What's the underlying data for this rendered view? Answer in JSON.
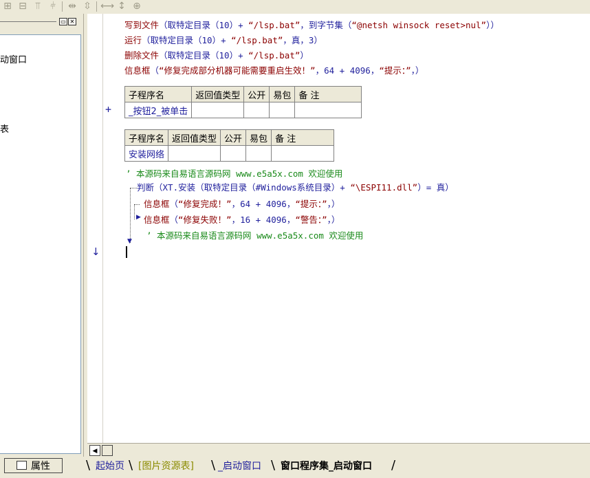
{
  "toolbar": {
    "icons": [
      "align-left-icon",
      "align-center-icon",
      "align-top-icon",
      "align-middle-icon",
      "space-horizontal-icon",
      "space-vertical-icon",
      "same-width-icon",
      "same-height-icon",
      "same-size-icon"
    ]
  },
  "left_panel": {
    "item_label": "动窗口",
    "item2_label": "表",
    "properties_button": "属性"
  },
  "code": {
    "line1": {
      "fn": "写到文件",
      "a": "（取特定目录（10）+ ",
      "s1": "“/lsp.bat”",
      "b": "，到字节集（",
      "s2": "“@netsh winsock reset>nul”",
      "c": "））"
    },
    "line2": {
      "fn": "运行",
      "a": "（取特定目录（10）+ ",
      "s1": "“/lsp.bat”",
      "b": "，真，3）"
    },
    "line3": {
      "fn": "删除文件",
      "a": "（取特定目录（10）+ ",
      "s1": "“/lsp.bat”",
      "b": "）"
    },
    "line4": {
      "fn": "信息框",
      "a": "（",
      "s1": "“修复完成部分机器可能需要重启生效！”",
      "b": "，64 + 4096，",
      "s2": "“提示：”",
      "c": "，）"
    },
    "line5": {
      "kw": "判断",
      "a": "（XT.安装（取特定目录（#Windows系统目录）+ ",
      "s1": "“\\ESPI11.dll”",
      "b": "）= 真）"
    },
    "line6": {
      "fn": "信息框",
      "a": "（",
      "s1": "“修复完成！”",
      "b": "，64 + 4096，",
      "s2": "“提示：”",
      "c": "，）"
    },
    "line7": {
      "fn": "信息框",
      "a": "（",
      "s1": "“修复失败！”",
      "b": "，16 + 4096，",
      "s2": "“警告：”",
      "c": "，）"
    },
    "comment1": "’ 本源码来自易语言源码网 www.e5a5x.com  欢迎使用",
    "comment2": "’ 本源码来自易语言源码网 www.e5a5x.com  欢迎使用"
  },
  "sub1": {
    "headers": [
      "子程序名",
      "返回值类型",
      "公开",
      "易包",
      "备 注"
    ],
    "row": [
      "_按钮2_被单击",
      "",
      "",
      "",
      ""
    ]
  },
  "sub2": {
    "headers": [
      "子程序名",
      "返回值类型",
      "公开",
      "易包",
      "备 注"
    ],
    "row": [
      "安装网络",
      "",
      "",
      "",
      ""
    ]
  },
  "tabs": [
    "起始页",
    "[图片资源表]",
    "_启动窗口",
    "窗口程序集_启动窗口"
  ],
  "colors": {
    "keyword": "#1f1f9c",
    "function": "#8b0000",
    "comment": "#1a8a1a",
    "tab_resource": "#8b8b00"
  }
}
